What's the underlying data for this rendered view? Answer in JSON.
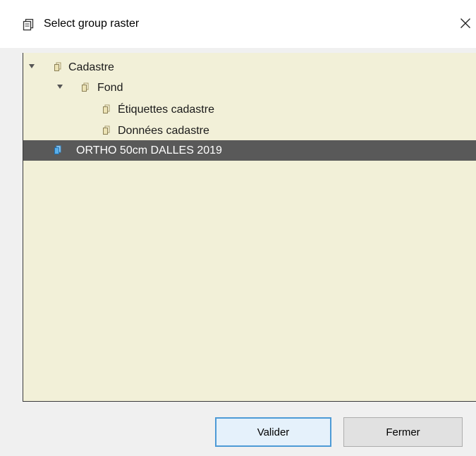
{
  "window": {
    "title": "Select group raster",
    "title_icon": "layer-group-icon",
    "close_icon": "close-icon"
  },
  "tree": {
    "background_color": "#f2f0d8",
    "selected_color": "#595959",
    "items": [
      {
        "label": "Cadastre",
        "level": 0,
        "expanded": true,
        "icon": "layer-group-icon"
      },
      {
        "label": "Fond",
        "level": 1,
        "expanded": true,
        "icon": "layer-group-icon"
      },
      {
        "label": "Étiquettes cadastre",
        "level": 2,
        "icon": "layer-group-icon"
      },
      {
        "label": "Données cadastre",
        "level": 2,
        "icon": "layer-group-icon"
      },
      {
        "label": "ORTHO 50cm DALLES 2019",
        "level": 0,
        "selected": true,
        "icon": "layer-group-icon"
      }
    ]
  },
  "buttons": {
    "validate_label": "Valider",
    "close_label": "Fermer"
  }
}
